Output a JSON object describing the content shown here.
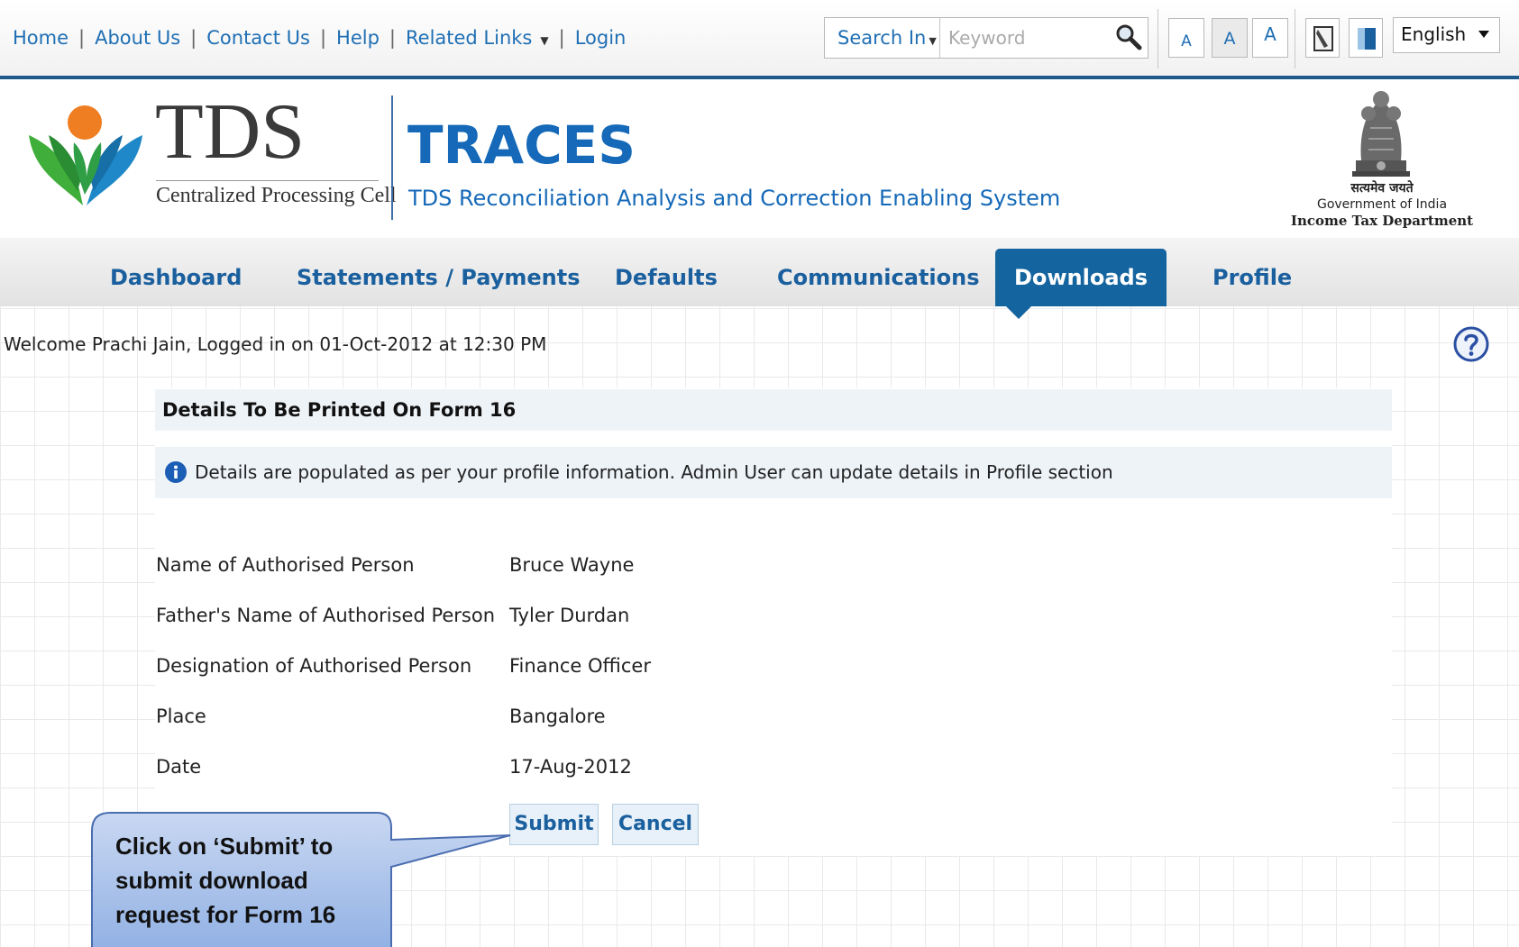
{
  "top_links": {
    "home": "Home",
    "about": "About Us",
    "contact": "Contact Us",
    "help": "Help",
    "related": "Related Links",
    "login": "Login",
    "separator": "|"
  },
  "search": {
    "search_in_label": "Search In",
    "placeholder": "Keyword"
  },
  "font_size_buttons": [
    "A",
    "A",
    "A"
  ],
  "language": "English",
  "header": {
    "logo_text": "TDS",
    "logo_subtitle": "Centralized Processing Cell",
    "app_name": "TRACES",
    "app_full_name": "TDS Reconciliation Analysis and Correction Enabling System",
    "gov_hindi": "सत्यमेव जयते",
    "gov_india": "Government of India",
    "department": "Income Tax Department"
  },
  "nav": {
    "items": [
      "Dashboard",
      "Statements / Payments",
      "Defaults",
      "Communications",
      "Downloads",
      "Profile"
    ],
    "active": "Downloads"
  },
  "welcome": "Welcome Prachi Jain, Logged in on 01-Oct-2012 at 12:30 PM",
  "form": {
    "section_title": "Details To Be Printed On Form 16",
    "info": "Details are populated as per your profile information. Admin User can update details in Profile section",
    "fields": [
      {
        "label": "Name of Authorised Person",
        "value": "Bruce Wayne"
      },
      {
        "label": "Father's Name of Authorised Person",
        "value": "Tyler Durdan"
      },
      {
        "label": "Designation of Authorised Person",
        "value": "Finance Officer"
      },
      {
        "label": "Place",
        "value": "Bangalore"
      },
      {
        "label": "Date",
        "value": "17-Aug-2012"
      }
    ],
    "submit": "Submit",
    "cancel": "Cancel"
  },
  "callout": {
    "line1": "Click on ‘Submit’ to",
    "line2": "submit download",
    "line3": "request for Form 16"
  },
  "colors": {
    "brand_blue": "#1569b8",
    "nav_active": "#14659f",
    "panel_bg": "#eef3f8",
    "callout_fill": "#9db8e6"
  }
}
